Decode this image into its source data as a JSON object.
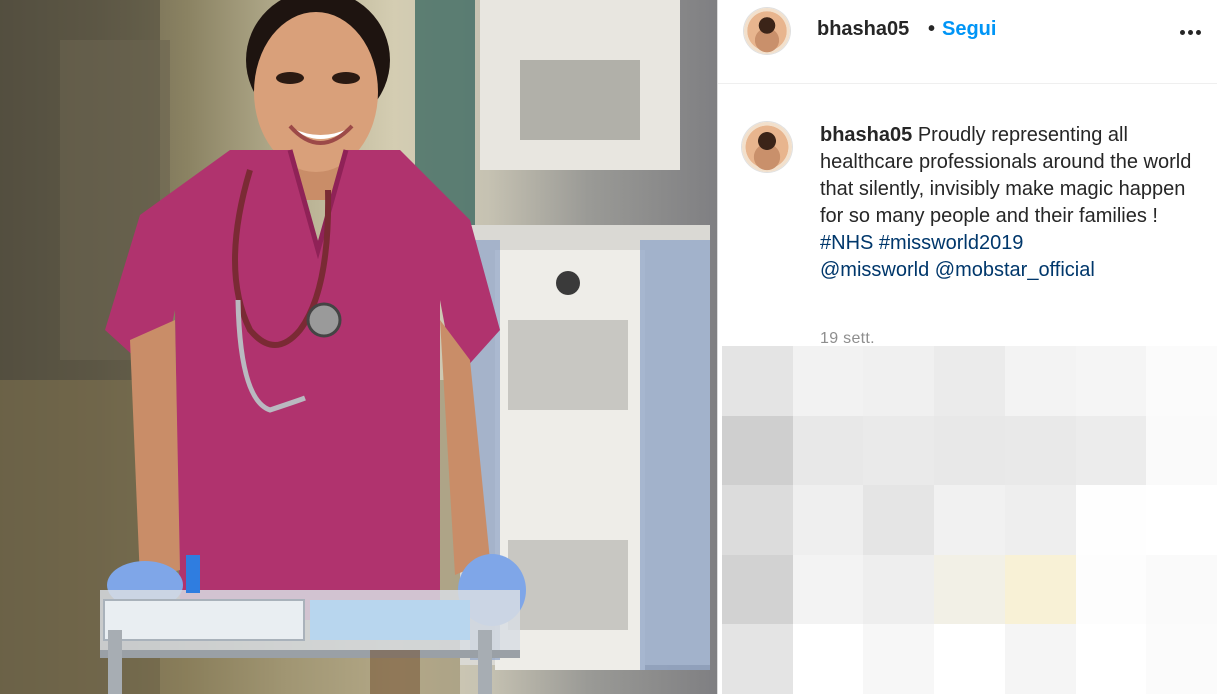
{
  "post": {
    "username": "bhasha05",
    "separator": "•",
    "follow_label": "Segui",
    "more_icon": "ellipsis-icon"
  },
  "caption": {
    "username": "bhasha05",
    "text": "Proudly representing all healthcare professionals around the world that silently, invisibly make magic happen for so many people and their families !",
    "hashtags": [
      "#NHS",
      "#missworld2019"
    ],
    "mentions": [
      "@missworld",
      "@mobstar_official"
    ],
    "timestamp": "19 sett."
  },
  "colors": {
    "follow": "#0095f6",
    "link": "#00376b",
    "scrubs": "#b0336e",
    "gloves": "#7fa6e8"
  },
  "pixel_cells": [
    "#e4e4e4",
    "#f2f2f2",
    "#f0f0f0",
    "#ebebeb",
    "#f3f3f3",
    "#f5f5f5",
    "#fbfbfb",
    "#cfcfcf",
    "#e8e8e8",
    "#eaeaea",
    "#e8e8e8",
    "#e9e9e9",
    "#ececec",
    "#fafafa",
    "#dcdcdc",
    "#efefef",
    "#e5e5e5",
    "#f1f1f1",
    "#eeeeee",
    "#fefefe",
    "#ffffff",
    "#d2d2d2",
    "#f3f3f3",
    "#eeeeee",
    "#f2f0e6",
    "#f8f1d6",
    "#fdfdfd",
    "#fafafa",
    "#e4e4e4",
    "#ffffff",
    "#f7f7f7",
    "#ffffff",
    "#f5f5f5",
    "#ffffff",
    "#fbfbfb"
  ]
}
